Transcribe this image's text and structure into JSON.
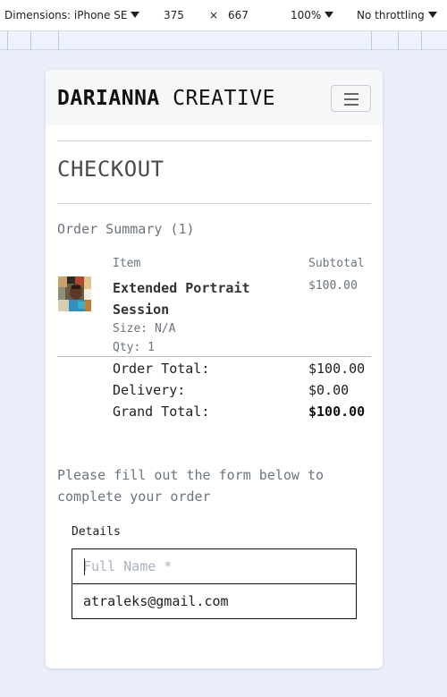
{
  "devtools": {
    "device_label": "Dimensions: iPhone SE",
    "width": "375",
    "times": "×",
    "height": "667",
    "zoom": "100%",
    "throttling": "No throttling"
  },
  "navbar": {
    "brand_bold": "DARIANNA",
    "brand_light": "CREATIVE",
    "toggler_icon": "hamburger-menu-icon"
  },
  "checkout": {
    "heading": "CHECKOUT",
    "summary_title": "Order Summary (1)",
    "columns": {
      "item": "Item",
      "subtotal": "Subtotal"
    },
    "item": {
      "name": "Extended Portrait Session",
      "size": "Size: N/A",
      "qty": "Qty: 1",
      "subtotal": "$100.00"
    },
    "totals": [
      {
        "label": "Order Total:",
        "value": "$100.00"
      },
      {
        "label": "Delivery:",
        "value": "$0.00"
      },
      {
        "label": "Grand Total:",
        "value": "$100.00"
      }
    ],
    "prompt": "Please fill out the form below to complete your order",
    "details_label": "Details",
    "full_name": {
      "placeholder": "Full Name *",
      "value": ""
    },
    "email": {
      "value": "atraleks@gmail.com"
    }
  }
}
